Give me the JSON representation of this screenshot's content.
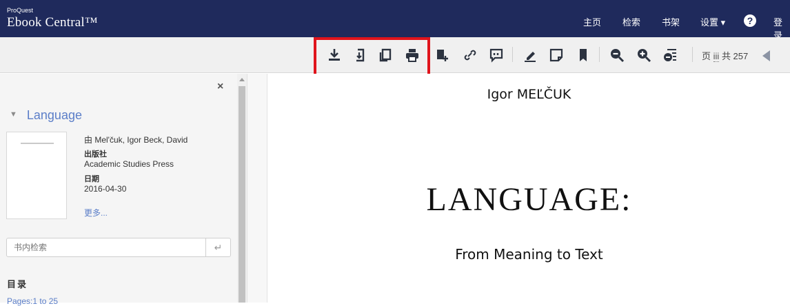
{
  "header": {
    "brand_small": "ProQuest",
    "brand_main": "Ebook Central™",
    "nav": [
      "主页",
      "检索",
      "书架",
      "设置 ▾",
      "登录"
    ],
    "help": "?"
  },
  "toolbar": {
    "icons": [
      "download-icon",
      "download-chapter-icon",
      "copy-icon",
      "print-icon",
      "add-to-bookshelf-icon",
      "link-icon",
      "cite-icon",
      "highlight-icon",
      "note-icon",
      "bookmark-icon",
      "zoom-out-icon",
      "zoom-in-icon",
      "page-settings-icon"
    ],
    "page_prefix": "页",
    "page_current": "iii",
    "page_total": "共 257"
  },
  "sidebar": {
    "close": "×",
    "title": "Language",
    "by": "由 Mel'čuk, Igor Beck, David",
    "publisher_label": "出版社",
    "publisher": "Academic Studies Press",
    "date_label": "日期",
    "date": "2016-04-30",
    "more": "更多...",
    "search_placeholder": "书内检索",
    "search_btn": "↵",
    "toc_title": "目录",
    "toc_first": "Pages:1 to 25"
  },
  "book_page": {
    "author": "Igor MEĽČUK",
    "title": "LANGUAGE:",
    "subtitle": "From Meaning to Text"
  },
  "colors": {
    "header_bg": "#1f2a5c",
    "link_blue": "#5b7ec8",
    "highlight_red": "#e0141c"
  }
}
